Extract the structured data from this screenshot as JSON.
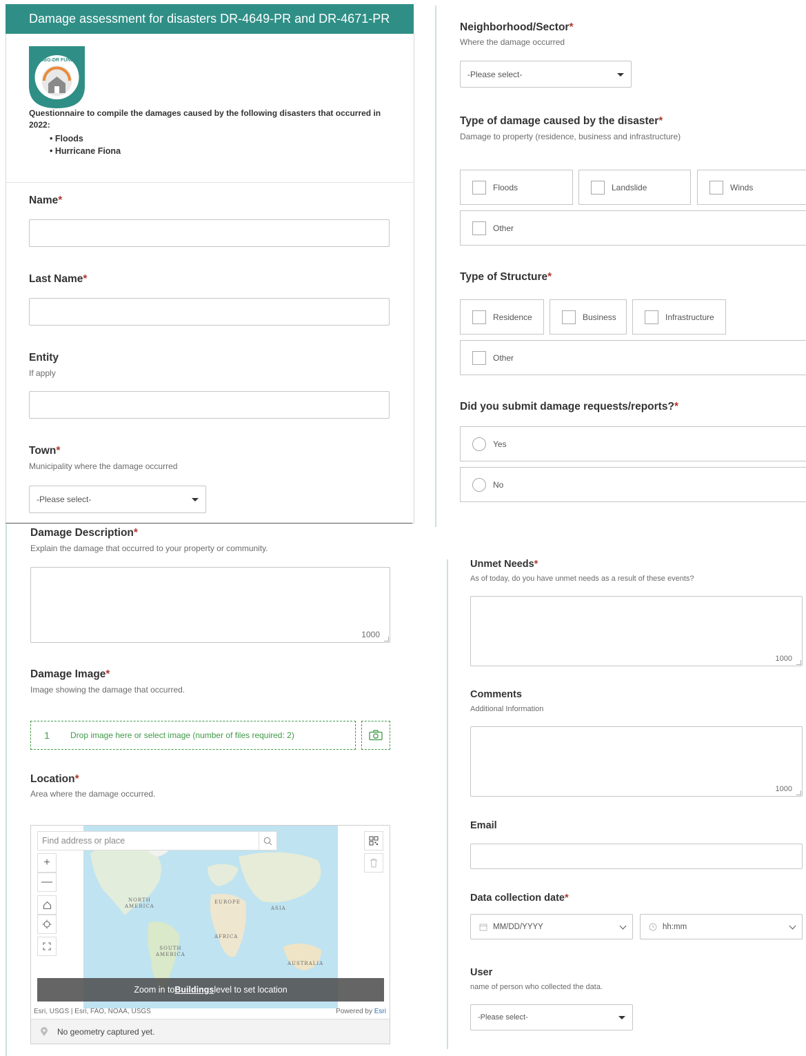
{
  "header": {
    "title": "Damage assessment for disasters DR-4649-PR and DR-4671-PR"
  },
  "logo": {
    "text": "CDBG-DR FUNDS"
  },
  "intro": {
    "text": "Questionnaire to compile the damages caused by the following disasters that occurred in 2022:",
    "items": [
      "Floods",
      "Hurricane Fiona"
    ]
  },
  "name": {
    "label": "Name",
    "required": "*"
  },
  "last_name": {
    "label": "Last Name",
    "required": "*"
  },
  "entity": {
    "label": "Entity",
    "desc": "If apply"
  },
  "town": {
    "label": "Town",
    "required": "*",
    "desc": "Municipality where the damage occurred",
    "value": "-Please select-"
  },
  "neighborhood": {
    "label": "Neighborhood/Sector",
    "required": "*",
    "desc": "Where the damage occurred",
    "value": "-Please select-"
  },
  "damage_type": {
    "label": "Type of damage caused by the disaster",
    "required": "*",
    "desc": "Damage to property (residence, business and infrastructure)",
    "options": [
      "Floods",
      "Landslide",
      "Winds",
      "Other"
    ]
  },
  "structure_type": {
    "label": "Type of Structure",
    "required": "*",
    "options": [
      "Residence",
      "Business",
      "Infrastructure",
      "Other"
    ]
  },
  "submitted": {
    "label": "Did you submit damage requests/reports?",
    "required": "*",
    "options": [
      "Yes",
      "No"
    ]
  },
  "damage_description": {
    "label": "Damage Description",
    "required": "*",
    "desc": "Explain the damage that occurred to your property or community.",
    "count": "1000"
  },
  "damage_image": {
    "label": "Damage Image",
    "required": "*",
    "desc": "Image showing the damage that occurred.",
    "drop_number": "1",
    "drop_text": "Drop image here or select image (number of files required: 2)"
  },
  "location": {
    "label": "Location",
    "required": "*",
    "desc": "Area where the damage occurred.",
    "search_placeholder": "Find address or place",
    "banner_pre": "Zoom in to ",
    "banner_link": "Buildings",
    "banner_post": " level to set location",
    "attribution": "Esri, USGS | Esri, FAO, NOAA, USGS",
    "powered_pre": "Powered by ",
    "powered_link": "Esri",
    "no_geometry": "No geometry captured yet.",
    "continents": {
      "north_america": "NORTH\nAMERICA",
      "europe": "EUROPE",
      "asia": "ASIA",
      "africa": "AFRICA",
      "south_america": "SOUTH\nAMERICA",
      "australia": "AUSTRALIA"
    }
  },
  "unmet_needs": {
    "label": "Unmet Needs",
    "required": "*",
    "desc": "As of today, do you have unmet needs as a result of these events?",
    "count": "1000"
  },
  "comments": {
    "label": "Comments",
    "desc": "Additional Information",
    "count": "1000"
  },
  "email": {
    "label": "Email"
  },
  "collection_date": {
    "label": "Data collection date",
    "required": "*",
    "date_placeholder": "MM/DD/YYYY",
    "time_placeholder": "hh:mm"
  },
  "user": {
    "label": "User",
    "desc": "name of person who collected the data.",
    "value": "-Please select-"
  },
  "colors": {
    "header": "#2f8f86",
    "required": "#b03a2e",
    "dropzone": "#3f9a46"
  }
}
